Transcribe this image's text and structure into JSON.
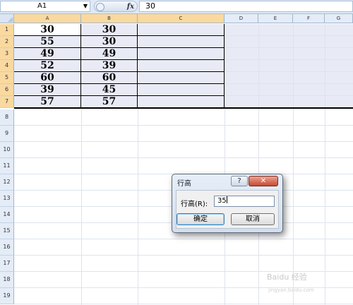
{
  "formula_bar": {
    "name_box": "A1",
    "name_box_arrow": "▼",
    "fx_label": "fx",
    "content": "30"
  },
  "columns": [
    "A",
    "B",
    "C",
    "D",
    "E",
    "F",
    "G"
  ],
  "rows": [
    "1",
    "2",
    "3",
    "4",
    "5",
    "6",
    "7",
    "8",
    "9",
    "10",
    "11",
    "12",
    "13",
    "14",
    "15",
    "16",
    "17",
    "18",
    "19"
  ],
  "data": [
    [
      "30",
      "30"
    ],
    [
      "55",
      "30"
    ],
    [
      "49",
      "49"
    ],
    [
      "52",
      "39"
    ],
    [
      "60",
      "60"
    ],
    [
      "39",
      "45"
    ],
    [
      "57",
      "57"
    ]
  ],
  "dialog": {
    "title": "行高",
    "help_label": "?",
    "close_label": "✕",
    "field_label": "行高(R):",
    "field_value": "35",
    "ok_label": "确定",
    "cancel_label": "取消"
  },
  "watermark": {
    "text": "Baidu 经验",
    "url": "jingyan.baidu.com"
  },
  "colors": {
    "selected_header": "#f9d99f",
    "header_bg": "#e4ecf7",
    "selection_fill": "#e8eaf6",
    "close_button": "#c84a30"
  }
}
